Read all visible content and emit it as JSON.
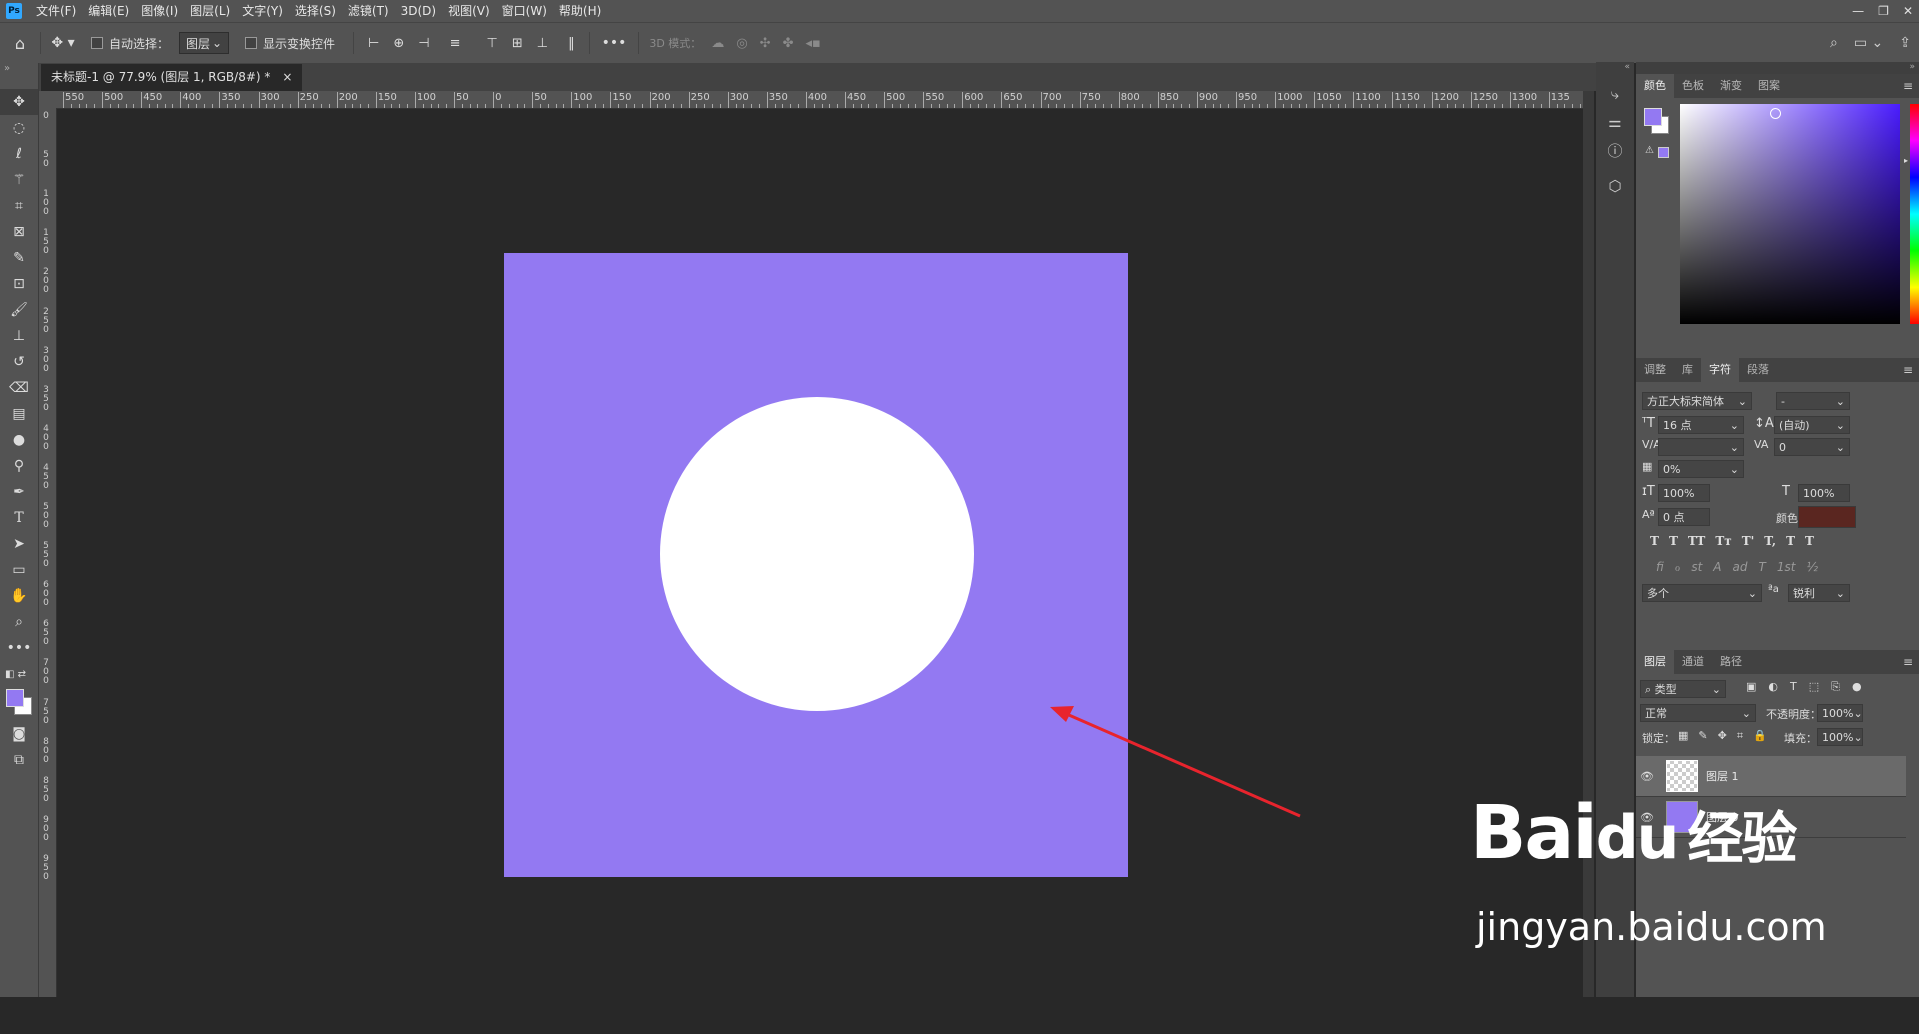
{
  "app": {
    "logo": "Ps"
  },
  "menu": [
    "文件(F)",
    "编辑(E)",
    "图像(I)",
    "图层(L)",
    "文字(Y)",
    "选择(S)",
    "滤镜(T)",
    "3D(D)",
    "视图(V)",
    "窗口(W)",
    "帮助(H)"
  ],
  "options_bar": {
    "auto_select_label": "自动选择：",
    "auto_select_value": "图层",
    "transform_controls_label": "显示变换控件",
    "mode_3d_label": "3D 模式："
  },
  "document": {
    "tab_title": "未标题-1 @ 77.9% (图层 1, RGB/8#) *",
    "close": "×"
  },
  "rulers": {
    "horizontal": [
      "550",
      "500",
      "450",
      "400",
      "350",
      "300",
      "250",
      "200",
      "150",
      "100",
      "50",
      "0",
      "50",
      "100",
      "150",
      "200",
      "250",
      "300",
      "350",
      "400",
      "450",
      "500",
      "550",
      "600",
      "650",
      "700",
      "750",
      "800",
      "850",
      "900",
      "950",
      "1000",
      "1050",
      "1100",
      "1150",
      "1200",
      "1250",
      "1300",
      "135"
    ],
    "vertical": [
      "0",
      "50",
      "100",
      "150",
      "200",
      "250",
      "300",
      "350",
      "400",
      "450",
      "500",
      "550",
      "600",
      "650",
      "700",
      "750",
      "800",
      "850",
      "900",
      "950"
    ]
  },
  "canvas": {
    "background_color": "#9379f2",
    "circle_color": "#ffffff",
    "arrow_color": "#e8242d"
  },
  "colors": {
    "foreground": "#9379f2",
    "background": "#ffffff"
  },
  "color_panel": {
    "tabs": [
      "颜色",
      "色板",
      "渐变",
      "图案"
    ]
  },
  "character_panel": {
    "tabs": [
      "调整",
      "库",
      "字符",
      "段落"
    ],
    "font_family": "方正大标宋简体",
    "font_style": "-",
    "font_size": "16 点",
    "leading": "(自动)",
    "kerning": "",
    "tracking": "0",
    "tsume": "0%",
    "vertical_scale": "100%",
    "horizontal_scale": "100%",
    "baseline_shift": "0 点",
    "color_label": "颜色：",
    "text_color": "#5a2620",
    "language": "多个",
    "antialias": "锐利",
    "style_buttons": [
      "T",
      "T",
      "TT",
      "Tт",
      "T'",
      "T,",
      "T",
      "T"
    ],
    "opentype_buttons": [
      "fi",
      "ℴ",
      "st",
      "A",
      "ad",
      "T",
      "1st",
      "½"
    ]
  },
  "layers_panel": {
    "tabs": [
      "图层",
      "通道",
      "路径"
    ],
    "filter_kind": "类型",
    "blend_mode": "正常",
    "opacity_label": "不透明度：",
    "opacity": "100%",
    "lock_label": "锁定：",
    "fill_label": "填充：",
    "fill": "100%",
    "layers": [
      {
        "name": "图层 1",
        "selected": true,
        "thumb": "transparent"
      },
      {
        "name": "图层 0",
        "selected": false,
        "thumb": "#9379f2"
      }
    ]
  },
  "watermark": {
    "brand": "Bai",
    "brand2": "du",
    "cn": "经验",
    "url": "jingyan.baidu.com"
  }
}
